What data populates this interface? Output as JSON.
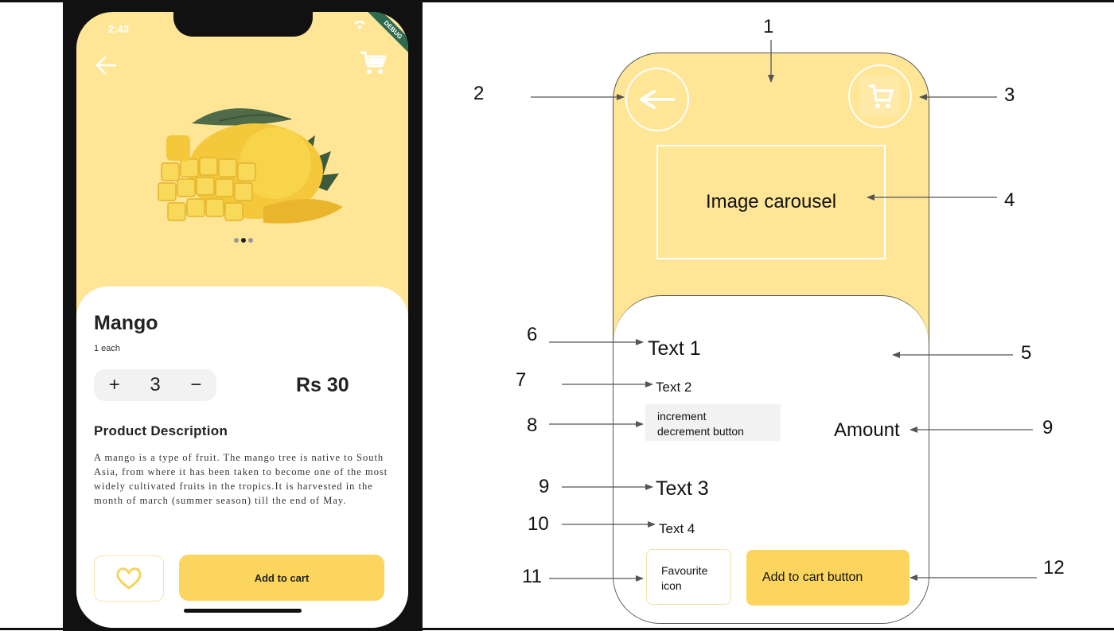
{
  "phone": {
    "status_time": "2:43",
    "debug_label": "DEBUG",
    "back_icon": "arrow-left-icon",
    "cart_icon": "shopping-cart-icon",
    "product_title": "Mango",
    "product_unit": "1 each",
    "stepper": {
      "plus": "+",
      "quantity": "3",
      "minus": "−"
    },
    "price": "Rs 30",
    "description_title": "Product Description",
    "description_text": "A mango is a type of fruit. The mango tree is native to South Asia, from where it has been taken to become one of the most widely cultivated fruits in the tropics.It is harvested in the month of march (summer season) till the end of May.",
    "carousel": {
      "count": 3,
      "active_index": 1
    },
    "favourite_icon": "heart-outline-icon",
    "add_to_cart_label": "Add to cart"
  },
  "wireframe": {
    "carousel_label": "Image carousel",
    "text1": "Text 1",
    "text2": "Text 2",
    "increment_line1": "increment",
    "increment_line2": "decrement button",
    "amount": "Amount",
    "text3": "Text 3",
    "text4": "Text 4",
    "favourite_line1": "Favourite",
    "favourite_line2": "icon",
    "add_to_cart_label": "Add to cart button"
  },
  "annotations": {
    "n1": "1",
    "n2": "2",
    "n3": "3",
    "n4": "4",
    "n5": "5",
    "n6": "6",
    "n7": "7",
    "n8": "8",
    "n9a": "9",
    "n9b": "9",
    "n10": "10",
    "n11": "11",
    "n12": "12"
  },
  "colors": {
    "header_yellow": "#ffe596",
    "button_yellow": "#fbd55e",
    "stepper_gray": "#f2f2f2",
    "arrow_color": "#555555"
  }
}
